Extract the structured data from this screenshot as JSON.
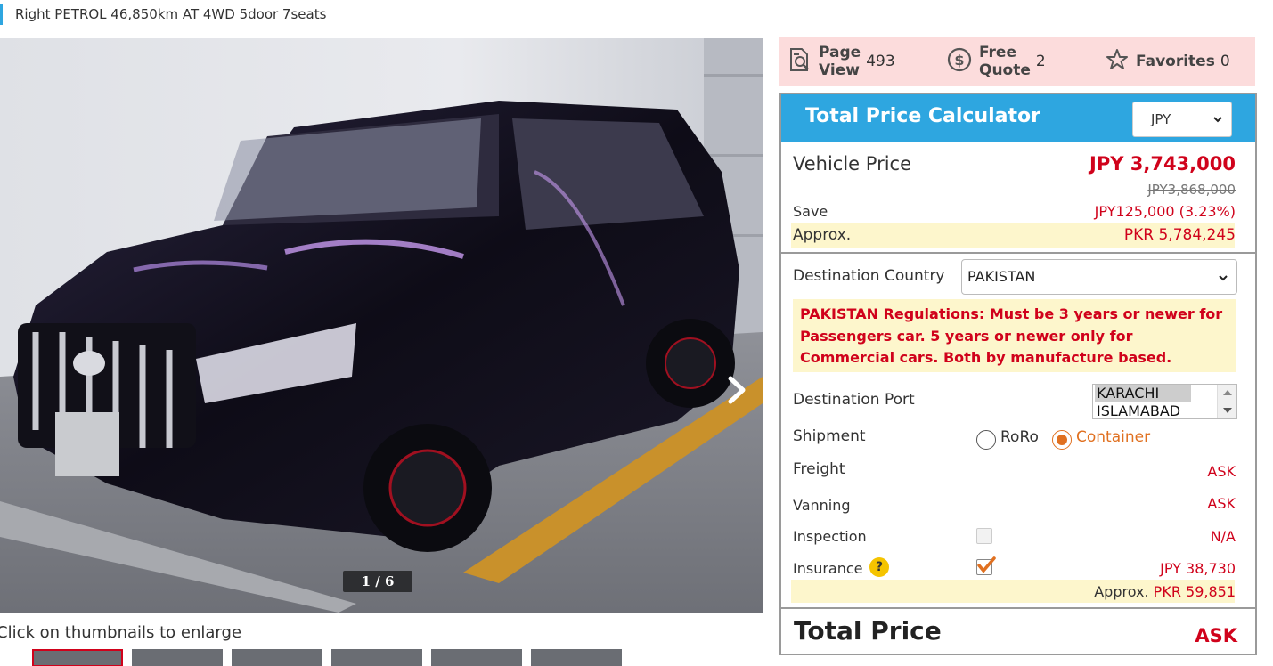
{
  "listing": {
    "subtitle": "Right PETROL 46,850km AT 4WD 5door 7seats",
    "photo_counter": "1 / 6",
    "thumb_hint": "Click on thumbnails to enlarge",
    "thumbnail_count": 6
  },
  "stats": {
    "page_view_label_1": "Page",
    "page_view_label_2": "View",
    "page_view_count": "493",
    "free_quote_label_1": "Free",
    "free_quote_label_2": "Quote",
    "free_quote_count": "2",
    "favorites_label": "Favorites",
    "favorites_count": "0"
  },
  "calculator": {
    "title": "Total Price Calculator",
    "currency": "JPY",
    "vehicle_price_label": "Vehicle Price",
    "vehicle_price": "JPY 3,743,000",
    "original_price": "JPY3,868,000",
    "save_label": "Save",
    "save_value": "JPY125,000 (3.23%)",
    "approx_label": "Approx.",
    "approx_value": "PKR 5,784,245",
    "destination_country_label": "Destination Country",
    "destination_country": "PAKISTAN",
    "regulation_notice": "PAKISTAN Regulations: Must be 3 years or newer for Passengers car. 5 years or newer only for Commercial cars. Both by manufacture based.",
    "destination_port_label": "Destination Port",
    "ports": [
      "KARACHI",
      "ISLAMABAD"
    ],
    "selected_port": "KARACHI",
    "shipment_label": "Shipment",
    "shipment_options": [
      "RoRo",
      "Container"
    ],
    "shipment_selected": "Container",
    "freight_label": "Freight",
    "freight_value": "ASK",
    "vanning_label": "Vanning",
    "vanning_value": "ASK",
    "inspection_label": "Inspection",
    "inspection_value": "N/A",
    "inspection_checked": false,
    "insurance_label": "Insurance",
    "insurance_help": "?",
    "insurance_value": "JPY 38,730",
    "insurance_checked": true,
    "insurance_approx_label": "Approx.",
    "insurance_approx_value": "PKR 59,851",
    "total_label": "Total Price",
    "total_value": "ASK"
  },
  "colors": {
    "accent_blue": "#2ea6e0",
    "price_red": "#d0021b",
    "highlight_yellow": "#fdf6cc",
    "stats_pink": "#fcdcdc",
    "radio_orange": "#e07020"
  }
}
